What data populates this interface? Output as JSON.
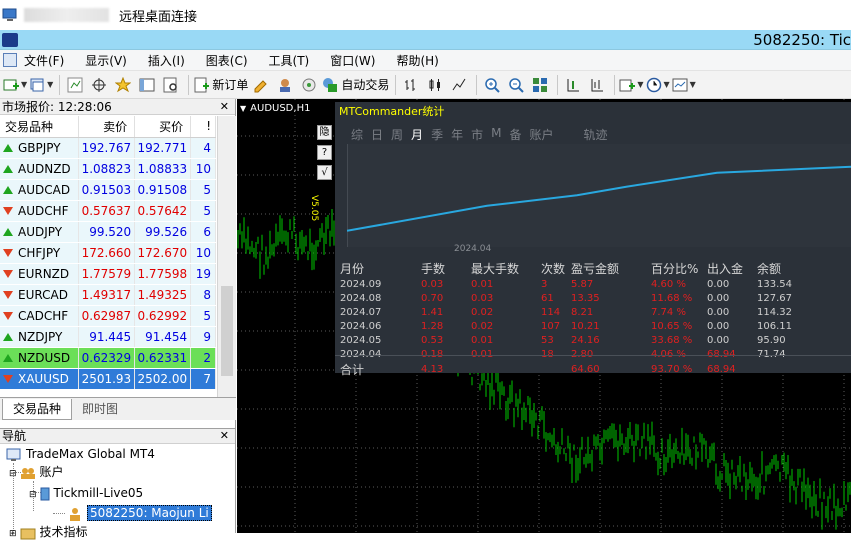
{
  "rdp": {
    "title": "远程桌面连接"
  },
  "mt4": {
    "title": "5082250: Tic"
  },
  "menu": [
    "文件(F)",
    "显示(V)",
    "插入(I)",
    "图表(C)",
    "工具(T)",
    "窗口(W)",
    "帮助(H)"
  ],
  "toolbar": {
    "new_order": "新订单",
    "auto_trade": "自动交易"
  },
  "market_watch": {
    "header": "市场报价: 12:28:06",
    "columns": [
      "交易品种",
      "卖价",
      "买价",
      "!"
    ],
    "rows": [
      {
        "symbol": "GBPJPY",
        "bid": "192.767",
        "ask": "192.771",
        "count": "4",
        "dir": "up",
        "color": "blue"
      },
      {
        "symbol": "AUDNZD",
        "bid": "1.08823",
        "ask": "1.08833",
        "count": "10",
        "dir": "up",
        "color": "blue"
      },
      {
        "symbol": "AUDCAD",
        "bid": "0.91503",
        "ask": "0.91508",
        "count": "5",
        "dir": "up",
        "color": "blue"
      },
      {
        "symbol": "AUDCHF",
        "bid": "0.57637",
        "ask": "0.57642",
        "count": "5",
        "dir": "down",
        "color": "red"
      },
      {
        "symbol": "AUDJPY",
        "bid": "99.520",
        "ask": "99.526",
        "count": "6",
        "dir": "up",
        "color": "blue"
      },
      {
        "symbol": "CHFJPY",
        "bid": "172.660",
        "ask": "172.670",
        "count": "10",
        "dir": "down",
        "color": "red"
      },
      {
        "symbol": "EURNZD",
        "bid": "1.77579",
        "ask": "1.77598",
        "count": "19",
        "dir": "down",
        "color": "red"
      },
      {
        "symbol": "EURCAD",
        "bid": "1.49317",
        "ask": "1.49325",
        "count": "8",
        "dir": "down",
        "color": "red"
      },
      {
        "symbol": "CADCHF",
        "bid": "0.62987",
        "ask": "0.62992",
        "count": "5",
        "dir": "down",
        "color": "red"
      },
      {
        "symbol": "NZDJPY",
        "bid": "91.445",
        "ask": "91.454",
        "count": "9",
        "dir": "up",
        "color": "blue"
      },
      {
        "symbol": "NZDUSD",
        "bid": "0.62329",
        "ask": "0.62331",
        "count": "2",
        "dir": "up",
        "color": "blue",
        "selected": "green"
      },
      {
        "symbol": "XAUUSD",
        "bid": "2501.93",
        "ask": "2502.00",
        "count": "7",
        "dir": "down",
        "color": "white",
        "selected": "blue"
      }
    ],
    "tabs": [
      "交易品种",
      "即时图"
    ]
  },
  "navigator": {
    "header": "导航",
    "items": [
      "TradeMax Global MT4",
      "账户",
      "Tickmill-Live05",
      "5082250: Maojun Li",
      "技术指标"
    ]
  },
  "chart": {
    "label": "AUDUSD,H1",
    "side_buttons": [
      "隐",
      "?",
      "√"
    ],
    "version": "V5.05"
  },
  "mtcommander": {
    "title": "MTCommander统计",
    "tabs": [
      "综",
      "日",
      "周",
      "月",
      "季",
      "年",
      "市",
      "M",
      "备",
      "账户",
      "轨迹"
    ],
    "active_tab": "月",
    "x_label": "2024.04",
    "columns": [
      "月份",
      "手数",
      "最大手数",
      "次数",
      "盈亏金额",
      "百分比%",
      "出入金",
      "余额"
    ],
    "rows": [
      [
        "2024.09",
        "0.03",
        "0.01",
        "3",
        "5.87",
        "4.60 %",
        "0.00",
        "133.54"
      ],
      [
        "2024.08",
        "0.70",
        "0.03",
        "61",
        "13.35",
        "11.68 %",
        "0.00",
        "127.67"
      ],
      [
        "2024.07",
        "1.41",
        "0.02",
        "114",
        "8.21",
        "7.74 %",
        "0.00",
        "114.32"
      ],
      [
        "2024.06",
        "1.28",
        "0.02",
        "107",
        "10.21",
        "10.65 %",
        "0.00",
        "106.11"
      ],
      [
        "2024.05",
        "0.53",
        "0.01",
        "53",
        "24.16",
        "33.68 %",
        "0.00",
        "95.90"
      ],
      [
        "2024.04",
        "0.18",
        "0.01",
        "18",
        "2.80",
        "4.06 %",
        "68.94",
        "71.74"
      ]
    ],
    "total": [
      "合计",
      "4.13",
      "",
      "",
      "64.60",
      "93.70 %",
      "68.94",
      ""
    ],
    "balance_curve": {
      "type": "line",
      "x": [
        "2024.04",
        "2024.05",
        "2024.06",
        "2024.07",
        "2024.08",
        "2024.09"
      ],
      "values": [
        71.74,
        95.9,
        106.11,
        114.32,
        127.67,
        133.54
      ]
    }
  },
  "colors": {
    "candle": "#00c800",
    "curve": "#29a8e0",
    "panel": "#2b3139",
    "loss_text": "#e02020"
  }
}
